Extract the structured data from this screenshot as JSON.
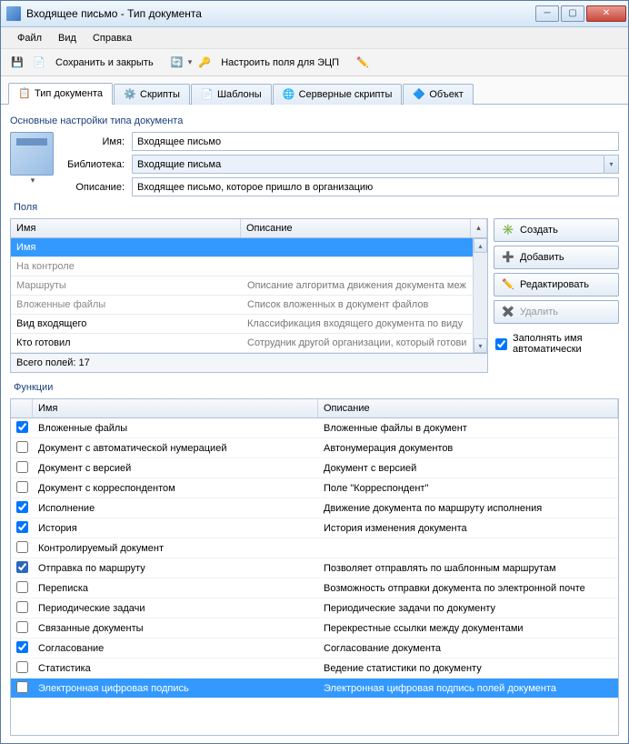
{
  "window": {
    "title": "Входящее письмо - Тип документа"
  },
  "menu": {
    "file": "Файл",
    "view": "Вид",
    "help": "Справка"
  },
  "toolbar": {
    "save_close": "Сохранить и закрыть",
    "configure_ecp": "Настроить поля для ЭЦП"
  },
  "tabs": {
    "doc_type": "Тип документа",
    "scripts": "Скрипты",
    "templates": "Шаблоны",
    "server_scripts": "Серверные скрипты",
    "object": "Объект"
  },
  "settings": {
    "heading": "Основные настройки типа документа",
    "name_label": "Имя:",
    "name_value": "Входящее письмо",
    "library_label": "Библиотека:",
    "library_value": "Входящие письма",
    "description_label": "Описание:",
    "description_value": "Входящее письмо, которое пришло в организацию"
  },
  "fields": {
    "label": "Поля",
    "col_name": "Имя",
    "col_desc": "Описание",
    "rows": [
      {
        "name": "Имя",
        "desc": "",
        "selected": true
      },
      {
        "name": "На контроле",
        "desc": "",
        "gray": true
      },
      {
        "name": "Маршруты",
        "desc": "Описание алгоритма движения документа меж",
        "gray": true
      },
      {
        "name": "Вложенные файлы",
        "desc": "Список вложенных в документ файлов",
        "gray": true
      },
      {
        "name": "Вид входящего",
        "desc": "Классификация входящего документа по виду"
      },
      {
        "name": "Кто готовил",
        "desc": "Сотрудник другой организации, который готови"
      }
    ],
    "total": "Всего полей: 17"
  },
  "buttons": {
    "create": "Создать",
    "add": "Добавить",
    "edit": "Редактировать",
    "delete": "Удалить",
    "autofill": "Заполнять имя автоматически"
  },
  "functions": {
    "label": "Функции",
    "col_name": "Имя",
    "col_desc": "Описание",
    "rows": [
      {
        "checked": true,
        "name": "Вложенные файлы",
        "desc": "Вложенные файлы в документ"
      },
      {
        "checked": false,
        "name": "Документ с автоматической нумерацией",
        "desc": "Автонумерация документов"
      },
      {
        "checked": false,
        "name": "Документ с версией",
        "desc": "Документ с версией"
      },
      {
        "checked": false,
        "name": "Документ с корреспондентом",
        "desc": "Поле \"Корреспондент\""
      },
      {
        "checked": true,
        "name": "Исполнение",
        "desc": "Движение документа по маршруту исполнения"
      },
      {
        "checked": true,
        "name": "История",
        "desc": "История изменения документа"
      },
      {
        "checked": false,
        "name": "Контролируемый документ",
        "desc": ""
      },
      {
        "checked": true,
        "name": "Отправка по маршруту",
        "desc": "Позволяет отправлять по шаблонным маршрутам",
        "special": true
      },
      {
        "checked": false,
        "name": "Переписка",
        "desc": "Возможность отправки документа по электронной почте"
      },
      {
        "checked": false,
        "name": "Периодические задачи",
        "desc": "Периодические задачи по документу"
      },
      {
        "checked": false,
        "name": "Связанные документы",
        "desc": "Перекрестные ссылки между документами"
      },
      {
        "checked": true,
        "name": "Согласование",
        "desc": "Согласование документа"
      },
      {
        "checked": false,
        "name": "Статистика",
        "desc": "Ведение статистики по документу"
      },
      {
        "checked": false,
        "name": "Электронная цифровая подпись",
        "desc": "Электронная цифровая подпись полей документа",
        "selected": true
      }
    ]
  }
}
